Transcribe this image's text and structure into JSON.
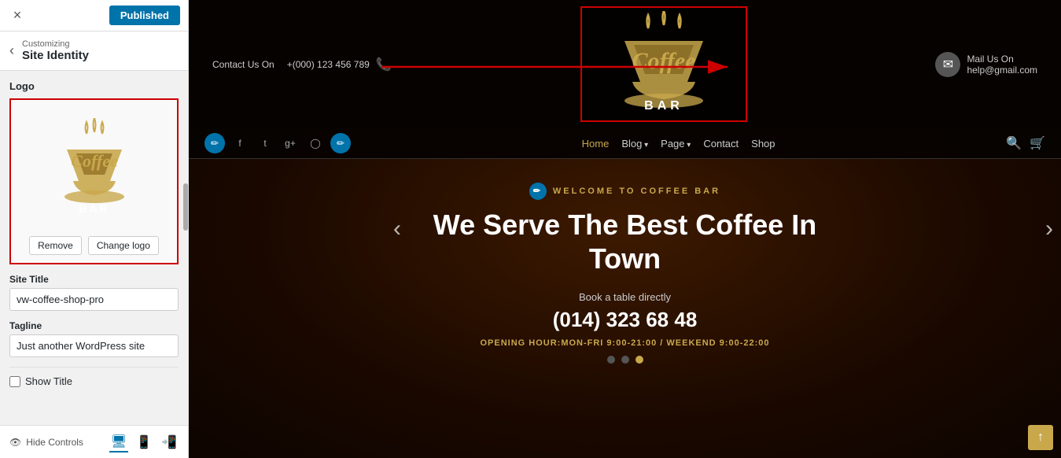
{
  "topbar": {
    "close_label": "×",
    "published_label": "Published"
  },
  "back_nav": {
    "back_label": "Customizing",
    "back_title": "Site Identity"
  },
  "logo_section": {
    "label": "Logo",
    "remove_btn": "Remove",
    "change_btn": "Change logo"
  },
  "site_title_field": {
    "label": "Site Title",
    "value": "vw-coffee-shop-pro"
  },
  "tagline_field": {
    "label": "Tagline",
    "value": "Just another WordPress site"
  },
  "show_title": {
    "label": "Show Title",
    "checked": false
  },
  "bottom_bar": {
    "hide_controls_label": "Hide Controls"
  },
  "preview": {
    "contact_label": "Contact Us On",
    "phone": "+(000) 123 456 789",
    "mail_label": "Mail Us On",
    "email": "help@gmail.com",
    "nav_items": [
      {
        "label": "Home",
        "active": true,
        "dropdown": false
      },
      {
        "label": "Blog",
        "active": false,
        "dropdown": true
      },
      {
        "label": "Page",
        "active": false,
        "dropdown": true
      },
      {
        "label": "Contact",
        "active": false,
        "dropdown": false
      },
      {
        "label": "Shop",
        "active": false,
        "dropdown": false
      }
    ],
    "hero_subtitle": "WELCOME TO COFFEE BAR",
    "hero_title_line1": "We Serve The Best Coffee In",
    "hero_title_line2": "Town",
    "book_label": "Book a table directly",
    "hero_phone": "(014) 323 68 48",
    "hours": "OPENING HOUR:MON-FRI 9:00-21:00 / WEEKEND 9:00-22:00",
    "scroll_top_icon": "↑"
  }
}
